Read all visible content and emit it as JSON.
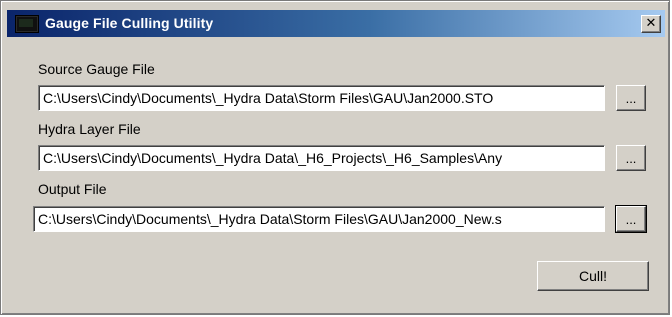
{
  "window": {
    "title": "Gauge File Culling Utility",
    "close_label": "✕"
  },
  "source": {
    "label": "Source Gauge File",
    "value": "C:\\Users\\Cindy\\Documents\\_Hydra Data\\Storm Files\\GAU\\Jan2000.STO",
    "browse_label": "..."
  },
  "layer": {
    "label": "Hydra Layer File",
    "value": "C:\\Users\\Cindy\\Documents\\_Hydra Data\\_H6_Projects\\_H6_Samples\\Any",
    "browse_label": "..."
  },
  "output": {
    "label": "Output File",
    "value": "C:\\Users\\Cindy\\Documents\\_Hydra Data\\Storm Files\\GAU\\Jan2000_New.s",
    "browse_label": "..."
  },
  "actions": {
    "cull_label": "Cull!"
  },
  "colors": {
    "titlebar_start": "#0a246a",
    "titlebar_end": "#a6caf0",
    "face": "#d4d0c8"
  }
}
